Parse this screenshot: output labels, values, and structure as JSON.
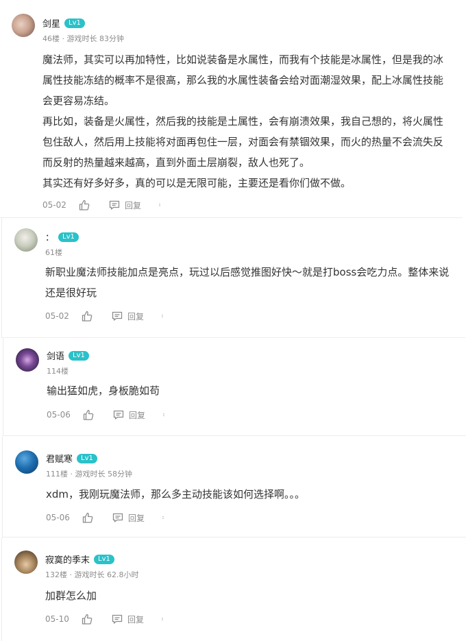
{
  "comments": [
    {
      "nick": "剑星",
      "level": "Lv1",
      "meta": "46楼 · 游戏时长 83分钟",
      "paragraphs": [
        "魔法师，其实可以再加特性，比如说装备是水属性，而我有个技能是冰属性，但是我的冰属性技能冻结的概率不是很高，那么我的水属性装备会给对面潮湿效果，配上冰属性技能会更容易冻结。",
        "再比如，装备是火属性，然后我的技能是土属性，会有崩溃效果，我自己想的，将火属性包住敌人，然后用上技能将对面再包住一层，对面会有禁锢效果，而火的热量不会流失反而反射的热量越来越高，直到外面土层崩裂，敌人也死了。",
        "其实还有好多好多，真的可以是无限可能，主要还是看你们做不做。"
      ],
      "date": "05-02",
      "reply": "回复",
      "avatar_color": "#c9a38f"
    },
    {
      "nick": "：",
      "level": "Lv1",
      "meta": "61楼",
      "paragraphs": [
        "新职业魔法师技能加点是亮点，玩过以后感觉推图好快～就是打boss会吃力点。整体来说还是很好玩"
      ],
      "date": "05-02",
      "reply": "回复",
      "avatar_color": "#b9c2b0"
    },
    {
      "nick": "剑语",
      "level": "Lv1",
      "meta": "114楼",
      "paragraphs": [
        "输出猛如虎，身板脆如苟"
      ],
      "date": "05-06",
      "reply": "回复",
      "avatar_color": "#5b3a6e"
    },
    {
      "nick": "君赋寒",
      "level": "Lv1",
      "meta": "111楼 · 游戏时长 58分钟",
      "paragraphs": [
        "xdm，我刚玩魔法师，那么多主动技能该如何选择啊。。。"
      ],
      "date": "05-06",
      "reply": "回复",
      "avatar_color": "#1f6fb0"
    },
    {
      "nick": "寂寞的季末",
      "level": "Lv1",
      "meta": "132楼 · 游戏时长 62.8小时",
      "paragraphs": [
        "加群怎么加"
      ],
      "date": "05-10",
      "reply": "回复",
      "avatar_color": "#8a6b47"
    }
  ]
}
